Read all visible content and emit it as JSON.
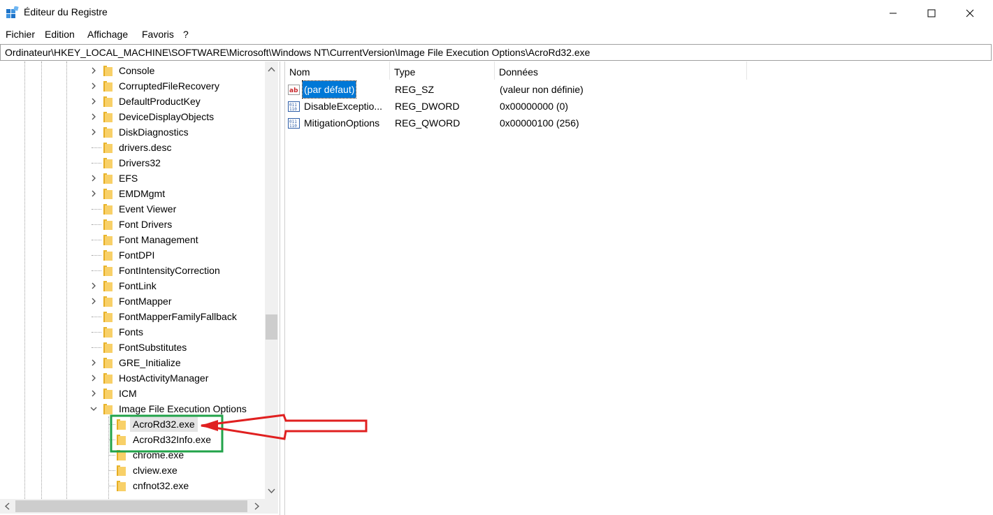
{
  "window": {
    "title": "Éditeur du Registre"
  },
  "menu": [
    "Fichier",
    "Edition",
    "Affichage",
    "Favoris",
    "?"
  ],
  "address": "Ordinateur\\HKEY_LOCAL_MACHINE\\SOFTWARE\\Microsoft\\Windows NT\\CurrentVersion\\Image File Execution Options\\AcroRd32.exe",
  "tree": {
    "items": [
      {
        "label": "Console",
        "expandable": true
      },
      {
        "label": "CorruptedFileRecovery",
        "expandable": true
      },
      {
        "label": "DefaultProductKey",
        "expandable": true
      },
      {
        "label": "DeviceDisplayObjects",
        "expandable": true
      },
      {
        "label": "DiskDiagnostics",
        "expandable": true
      },
      {
        "label": "drivers.desc",
        "expandable": false
      },
      {
        "label": "Drivers32",
        "expandable": false
      },
      {
        "label": "EFS",
        "expandable": true
      },
      {
        "label": "EMDMgmt",
        "expandable": true
      },
      {
        "label": "Event Viewer",
        "expandable": false
      },
      {
        "label": "Font Drivers",
        "expandable": false
      },
      {
        "label": "Font Management",
        "expandable": false
      },
      {
        "label": "FontDPI",
        "expandable": false
      },
      {
        "label": "FontIntensityCorrection",
        "expandable": false
      },
      {
        "label": "FontLink",
        "expandable": true
      },
      {
        "label": "FontMapper",
        "expandable": true
      },
      {
        "label": "FontMapperFamilyFallback",
        "expandable": false
      },
      {
        "label": "Fonts",
        "expandable": false
      },
      {
        "label": "FontSubstitutes",
        "expandable": false
      },
      {
        "label": "GRE_Initialize",
        "expandable": true
      },
      {
        "label": "HostActivityManager",
        "expandable": true
      },
      {
        "label": "ICM",
        "expandable": true
      },
      {
        "label": "Image File Execution Options",
        "expandable": true,
        "expanded": true
      }
    ],
    "children": [
      {
        "label": "AcroRd32.exe",
        "selected": true
      },
      {
        "label": "AcroRd32Info.exe"
      },
      {
        "label": "chrome.exe"
      },
      {
        "label": "clview.exe"
      },
      {
        "label": "cnfnot32.exe"
      }
    ]
  },
  "list": {
    "columns": [
      "Nom",
      "Type",
      "Données"
    ],
    "rows": [
      {
        "name": "(par défaut)",
        "type": "REG_SZ",
        "data": "(valeur non définie)",
        "icon": "string-value-icon",
        "selected": true
      },
      {
        "name": "DisableExceptio...",
        "type": "REG_DWORD",
        "data": "0x00000000 (0)",
        "icon": "binary-value-icon"
      },
      {
        "name": "MitigationOptions",
        "type": "REG_QWORD",
        "data": "0x00000100 (256)",
        "icon": "binary-value-icon"
      }
    ]
  },
  "colors": {
    "selection": "#0078d7",
    "annotation_box": "#22a34a",
    "annotation_arrow": "#e02020",
    "folder": "#f8d068"
  }
}
